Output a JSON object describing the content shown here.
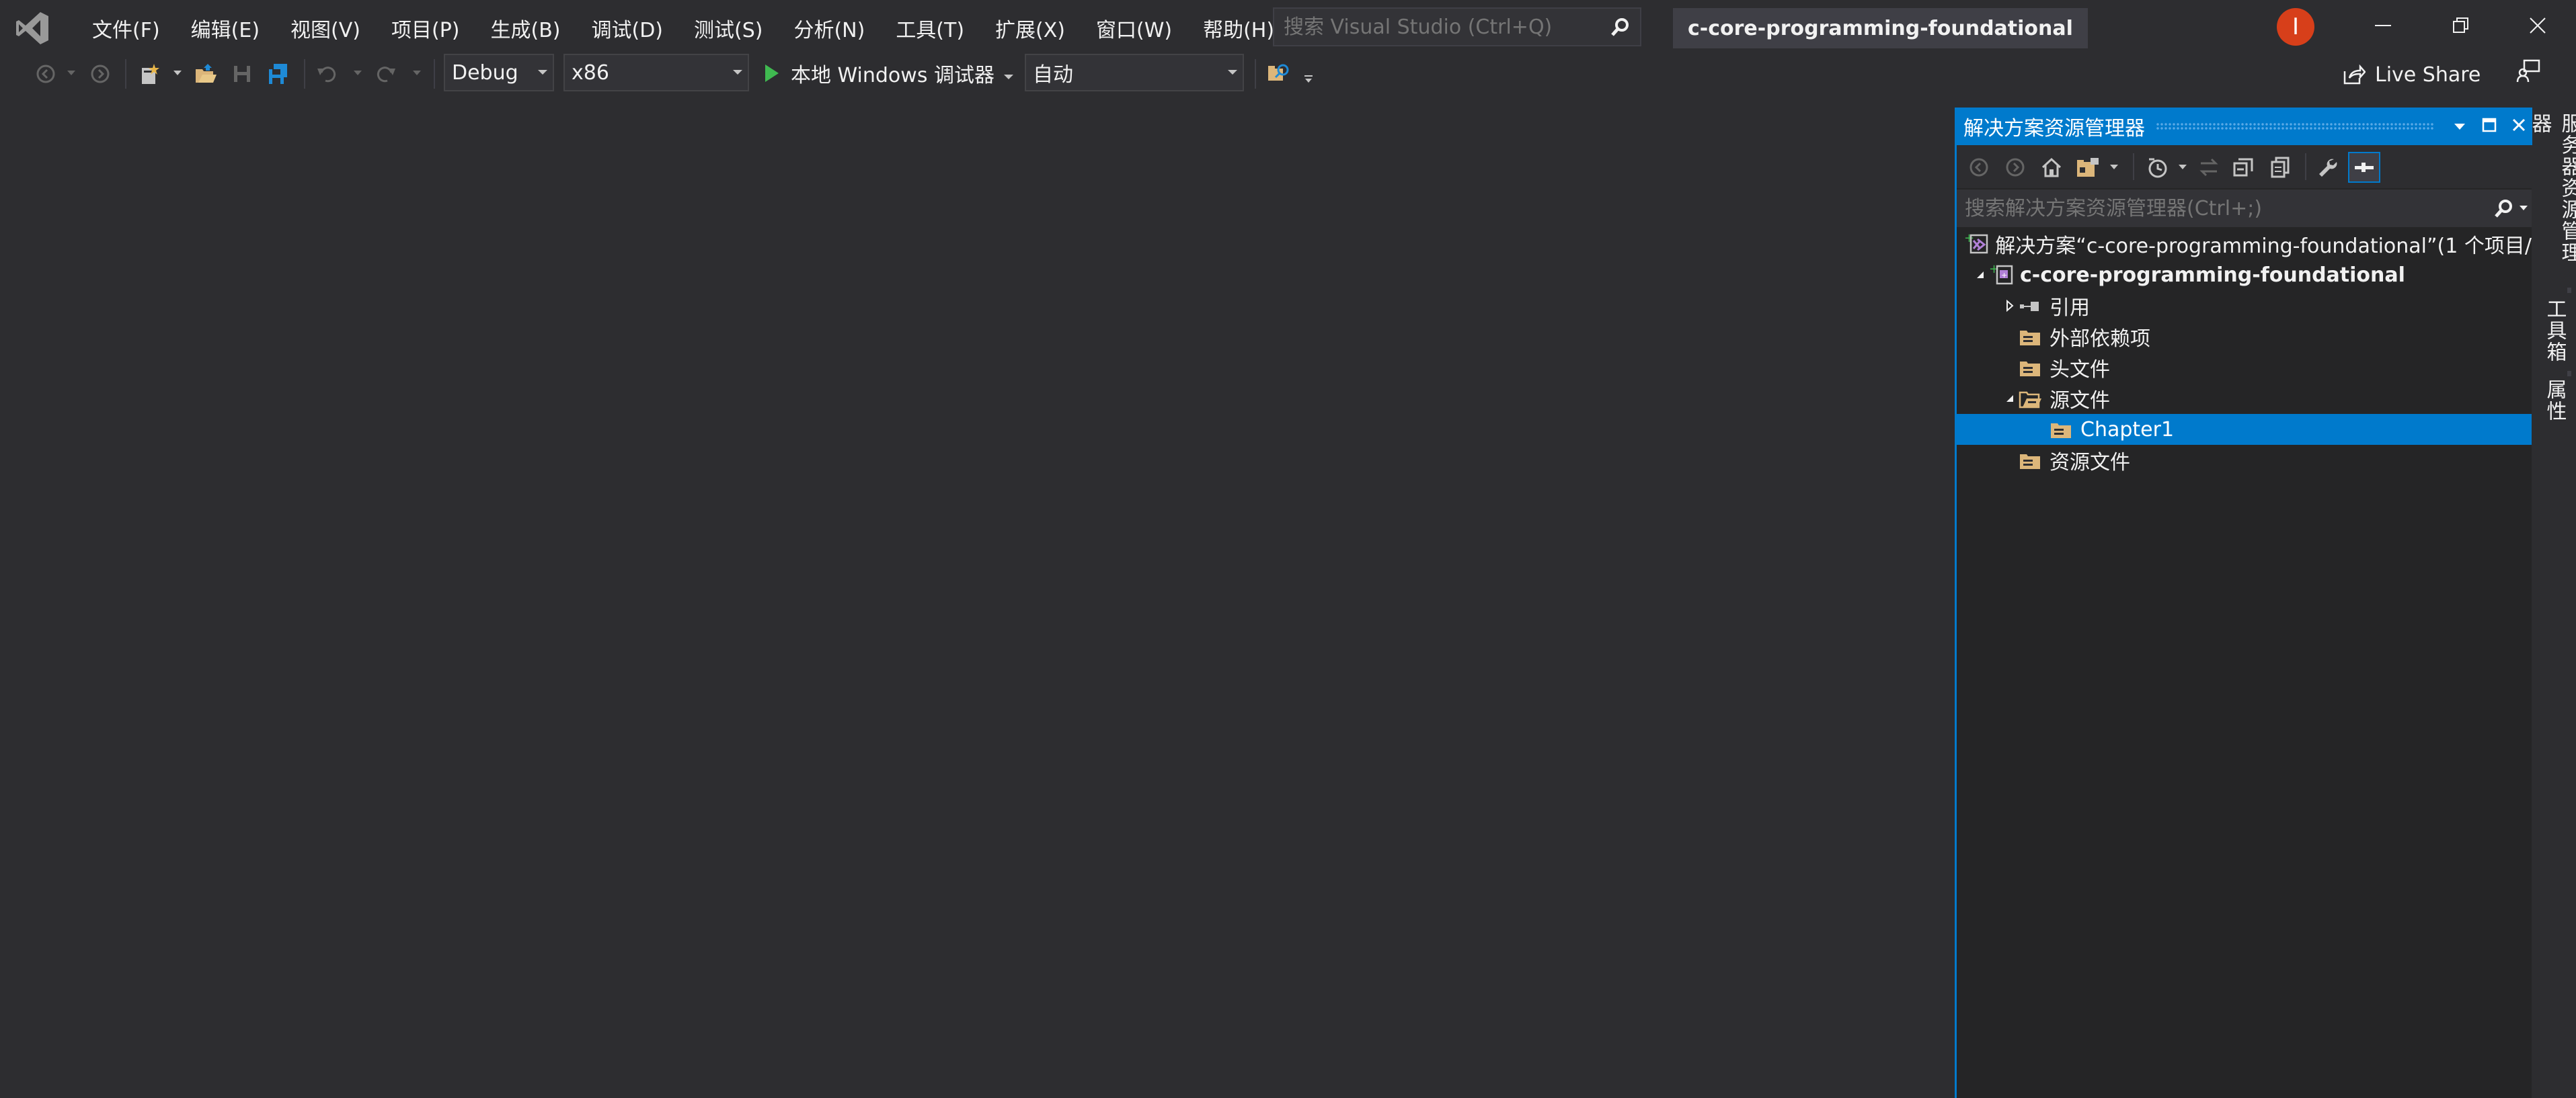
{
  "menu": {
    "items": [
      {
        "label": "文件(F)"
      },
      {
        "label": "编辑(E)"
      },
      {
        "label": "视图(V)"
      },
      {
        "label": "项目(P)"
      },
      {
        "label": "生成(B)"
      },
      {
        "label": "调试(D)"
      },
      {
        "label": "测试(S)"
      },
      {
        "label": "分析(N)"
      },
      {
        "label": "工具(T)"
      },
      {
        "label": "扩展(X)"
      },
      {
        "label": "窗口(W)"
      },
      {
        "label": "帮助(H)"
      }
    ],
    "search_placeholder": "搜索 Visual Studio (Ctrl+Q)",
    "solution_name": "c-core-programming-foundational",
    "avatar_initial": "I",
    "accent": "#007acc",
    "avatar_color": "#d73f1a"
  },
  "toolbar": {
    "configuration": "Debug",
    "platform": "x86",
    "start_label": "本地 Windows 调试器",
    "start_mode": "自动",
    "live_share_label": "Live Share",
    "play_color": "#3fb950"
  },
  "solution_explorer": {
    "title": "解决方案资源管理器",
    "search_placeholder": "搜索解决方案资源管理器(Ctrl+;)",
    "tree": [
      {
        "label": "解决方案“c-core-programming-foundational”(1 个项目/",
        "icon": "solution-icon",
        "expanded": null,
        "selected": false,
        "bold": false
      },
      {
        "label": "c-core-programming-foundational",
        "icon": "cpp-project-icon",
        "expanded": true,
        "selected": false,
        "bold": true
      },
      {
        "label": "引用",
        "icon": "references-icon",
        "expanded": false,
        "selected": false,
        "bold": false
      },
      {
        "label": "外部依赖项",
        "icon": "filter-folder-icon",
        "expanded": null,
        "selected": false,
        "bold": false
      },
      {
        "label": "头文件",
        "icon": "filter-folder-icon",
        "expanded": null,
        "selected": false,
        "bold": false
      },
      {
        "label": "源文件",
        "icon": "filter-folder-open-icon",
        "expanded": true,
        "selected": false,
        "bold": false
      },
      {
        "label": "Chapter1",
        "icon": "filter-folder-icon",
        "expanded": null,
        "selected": true,
        "bold": false
      },
      {
        "label": "资源文件",
        "icon": "filter-folder-icon",
        "expanded": null,
        "selected": false,
        "bold": false
      }
    ]
  },
  "side_tabs": [
    {
      "label": "服务器资源管理器"
    },
    {
      "label": "工具箱"
    },
    {
      "label": "属性"
    }
  ]
}
